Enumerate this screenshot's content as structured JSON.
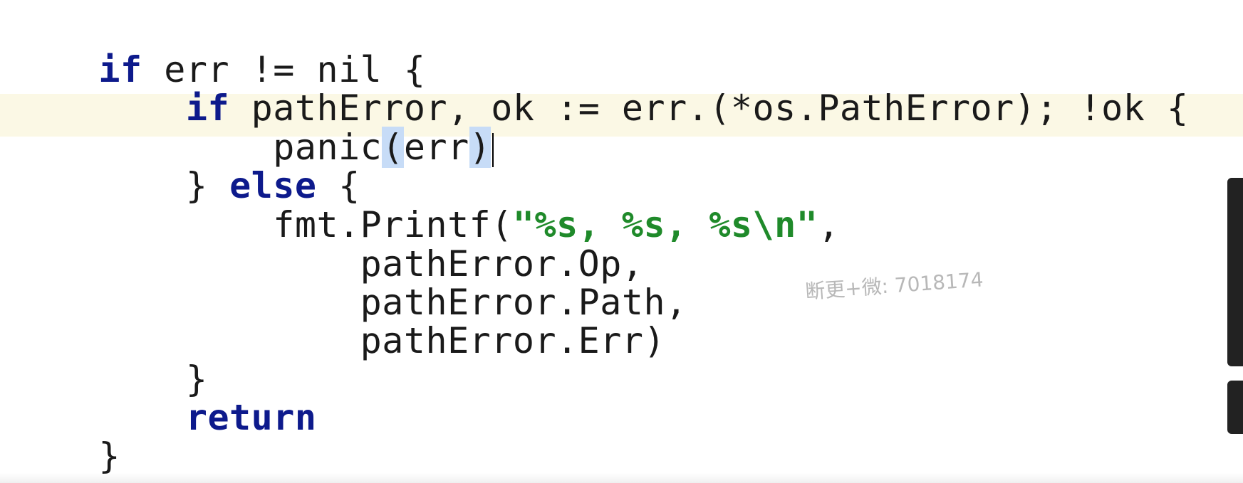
{
  "editor": {
    "clipped_top_line": "                         ...",
    "lines": {
      "l1": {
        "kw": "if",
        "rest": " err != nil {"
      },
      "l2": {
        "indent": "    ",
        "kw": "if",
        "rest": " pathError, ok := err.(*os.PathError); !ok {"
      },
      "l3": {
        "indent": "        ",
        "fn": "panic",
        "open": "(",
        "arg": "err",
        "close": ")"
      },
      "l4": {
        "indent": "    ",
        "pre": "} ",
        "kw": "else",
        "rest": " {"
      },
      "l5": {
        "indent": "        ",
        "pre": "fmt.Printf(",
        "str": "\"%s, %s, %s\\n\"",
        "rest": ","
      },
      "l6": {
        "indent": "            ",
        "text": "pathError.Op,"
      },
      "l7": {
        "indent": "            ",
        "text": "pathError.Path,"
      },
      "l8": {
        "indent": "            ",
        "text": "pathError.Err)"
      },
      "l9": {
        "indent": "    ",
        "text": "}"
      },
      "l10": {
        "indent": "    ",
        "kw": "return"
      },
      "l11": {
        "text": "}"
      }
    }
  },
  "watermark": {
    "text": "断更+微: 7018174"
  },
  "colors": {
    "keyword": "#0d1a8c",
    "string": "#1f8a2a",
    "caret_line": "#fbf8e5",
    "brace_match": "#c7dcf7"
  }
}
